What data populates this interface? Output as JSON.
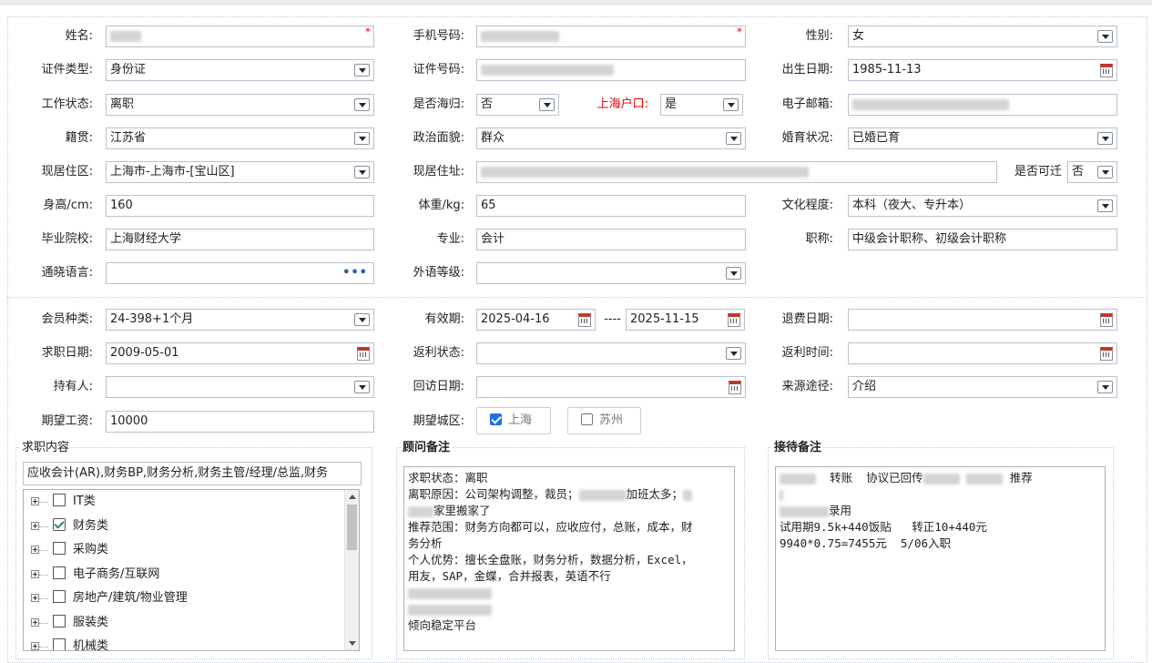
{
  "basic": {
    "name_label": "姓名:",
    "phone_label": "手机号码:",
    "gender_label": "性别:",
    "gender": "女",
    "idtype_label": "证件类型:",
    "idtype": "身份证",
    "idno_label": "证件号码:",
    "birth_label": "出生日期:",
    "birth": "1985-11-13",
    "work_label": "工作状态:",
    "work": "离职",
    "abroad_label": "是否海归:",
    "abroad": "否",
    "hukou_label": "上海户口:",
    "hukou": "是",
    "email_label": "电子邮箱:",
    "native_label": "籍贯:",
    "native": "江苏省",
    "politics_label": "政治面貌:",
    "politics": "群众",
    "marital_label": "婚育状况:",
    "marital": "已婚已育",
    "region_label": "现居住区:",
    "region": "上海市-上海市-[宝山区]",
    "address_label": "现居住址:",
    "relocate_label": "是否可迁",
    "relocate": "否",
    "height_label": "身高/cm:",
    "height": "160",
    "weight_label": "体重/kg:",
    "weight": "65",
    "edu_label": "文化程度:",
    "edu": "本科（夜大、专升本）",
    "school_label": "毕业院校:",
    "school": "上海财经大学",
    "major_label": "专业:",
    "major": "会计",
    "title_label": "职称:",
    "title": "中级会计职称、初级会计职称",
    "lang_label": "通晓语言:",
    "langlevel_label": "外语等级:"
  },
  "member": {
    "type_label": "会员种类:",
    "type": "24-398+1个月",
    "valid_label": "有效期:",
    "valid_from": "2025-04-16",
    "valid_sep": "----",
    "valid_to": "2025-11-15",
    "refund_label": "退费日期:",
    "jobdate_label": "求职日期:",
    "jobdate": "2009-05-01",
    "rebate_label": "返利状态:",
    "rebatetime_label": "返利时间:",
    "holder_label": "持有人:",
    "revisit_label": "回访日期:",
    "source_label": "来源途径:",
    "source": "介绍",
    "salary_label": "期望工资:",
    "salary": "10000",
    "city_label": "期望城区:",
    "city1": "上海",
    "city2": "苏州"
  },
  "jobs": {
    "legend": "求职内容",
    "summary": "应收会计(AR),财务BP,财务分析,财务主管/经理/总监,财务",
    "items": [
      "IT类",
      "财务类",
      "采购类",
      "电子商务/互联网",
      "房地产/建筑/物业管理",
      "服装类",
      "机械类"
    ]
  },
  "advisor": {
    "legend": "顾问备注",
    "l1": "求职状态：离职",
    "l2a": "离职原因：公司架构调整，裁员；",
    "l2b": "加班太多；",
    "l3": "家里搬家了",
    "l4": "推荐范围：财务方向都可以，应收应付，总账，成本，财",
    "l5": "务分析",
    "l6": "个人优势：擅长全盘账，财务分析，数据分析，Excel，",
    "l7": "用友，SAP，金蝶，合并报表，英语不行",
    "l10": "倾向稳定平台"
  },
  "reception": {
    "legend": "接待备注",
    "l1a": "转账",
    "l1b": "协议已回传",
    "l1c": "推荐",
    "l3": "录用",
    "l4": "试用期9.5k+440饭贴   转正10+440元",
    "l5": "9940*0.75=7455元  5/06入职"
  }
}
